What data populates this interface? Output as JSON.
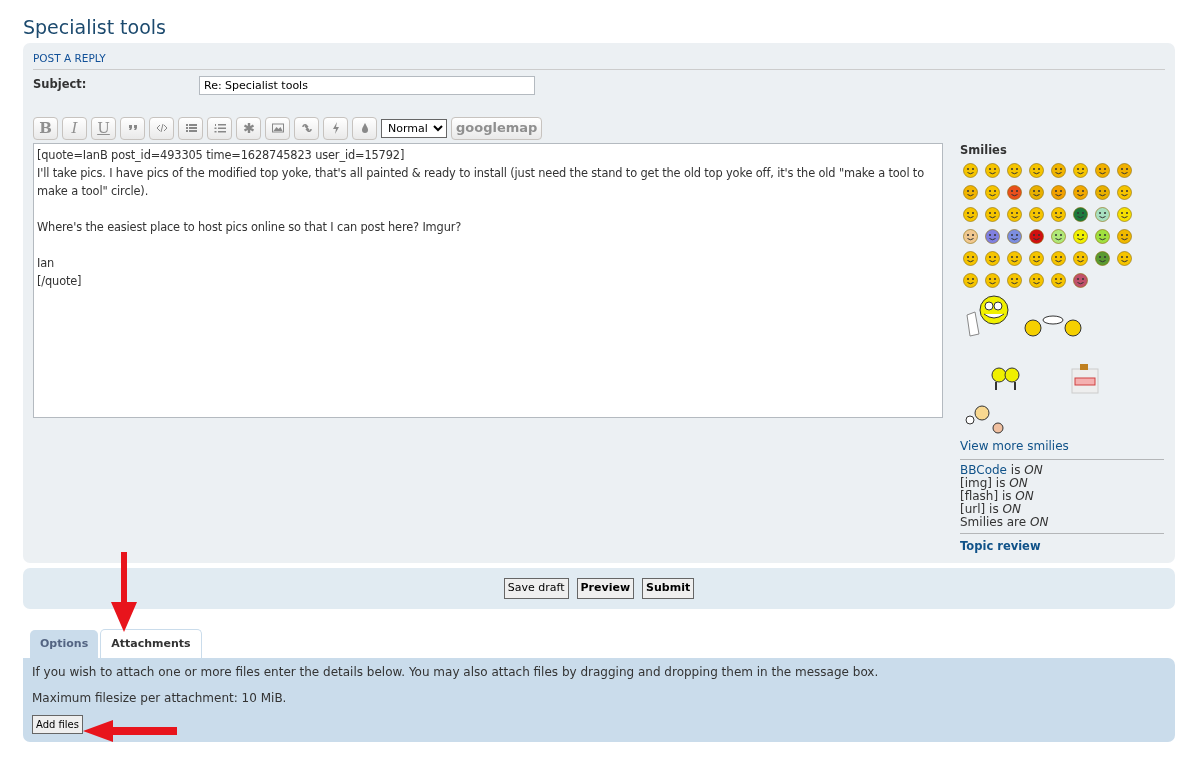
{
  "page_title": "Specialist tools",
  "post_panel": {
    "heading": "POST A REPLY",
    "subject_label": "Subject:",
    "subject_value": "Re: Specialist tools",
    "toolbar": [
      {
        "kind": "text",
        "label": "B"
      },
      {
        "kind": "text",
        "label": "I"
      },
      {
        "kind": "text",
        "label": "U"
      },
      {
        "kind": "icon"
      },
      {
        "kind": "icon"
      },
      {
        "kind": "icon"
      },
      {
        "kind": "icon"
      },
      {
        "kind": "icon"
      },
      {
        "kind": "icon"
      },
      {
        "kind": "icon"
      },
      {
        "kind": "icon"
      },
      {
        "kind": "icon"
      },
      {
        "kind": "select",
        "value": "Normal"
      },
      {
        "kind": "text",
        "label": "googlemap"
      }
    ],
    "message": "[quote=IanB post_id=493305 time=1628745823 user_id=15792]\nI'll take pics. I have pics of the modified top yoke, that's all painted & ready to install (just need the stand to get the old top yoke off, it's the old \"make a tool to make a tool\" circle).\n\nWhere's the easiest place to host pics online so that I can post here? Imgur?\n\nIan\n[/quote]",
    "smilies_heading": "Smilies",
    "smilies": [
      [
        {
          "color": "#f5c400"
        },
        {
          "color": "#f5c400"
        },
        {
          "color": "#f5c400"
        },
        {
          "color": "#f5c400"
        },
        {
          "color": "#f0b400"
        },
        {
          "color": "#f5c400"
        },
        {
          "color": "#f0b000"
        },
        {
          "color": "#f0b000"
        }
      ],
      [
        {
          "color": "#f0b400"
        },
        {
          "color": "#f5c400"
        },
        {
          "color": "#e8501c"
        },
        {
          "color": "#e8b000"
        },
        {
          "color": "#f0a000"
        },
        {
          "color": "#f0a800"
        },
        {
          "color": "#e8b000"
        },
        {
          "color": "#f5c400"
        }
      ],
      [
        {
          "color": "#f5c400"
        },
        {
          "color": "#f5c400"
        },
        {
          "color": "#f5c400"
        },
        {
          "color": "#f5c400"
        },
        {
          "color": "#f5c400"
        },
        {
          "color": "#1e7a3c"
        },
        {
          "color": "#a8e0c0"
        },
        {
          "color": "#f5e000"
        }
      ],
      [
        {
          "color": "#f0c890"
        },
        {
          "color": "#8080e0"
        },
        {
          "color": "#7c8ee0"
        },
        {
          "color": "#d01010"
        },
        {
          "color": "#b0e878"
        },
        {
          "color": "#f0f000"
        },
        {
          "color": "#a0e040"
        },
        {
          "color": "#f0b800"
        }
      ],
      [
        {
          "color": "#f5c400"
        },
        {
          "color": "#f5c400"
        },
        {
          "color": "#f5c400"
        },
        {
          "color": "#f5c400"
        },
        {
          "color": "#f5c400"
        },
        {
          "color": "#f5c400"
        },
        {
          "color": "#5a9a30"
        },
        {
          "color": "#f5c400"
        }
      ],
      [
        {
          "color": "#f5c400"
        },
        {
          "color": "#f5c400"
        },
        {
          "color": "#f5c400"
        },
        {
          "color": "#f5c400"
        },
        {
          "color": "#f5c400"
        },
        {
          "color": "#c0506a"
        }
      ]
    ],
    "more_smilies": "View more smilies",
    "status": [
      {
        "text": "BBCode",
        "link": true,
        "suffix": "is",
        "value": "ON"
      },
      {
        "text": "[img]",
        "link": false,
        "suffix": "is",
        "value": "ON"
      },
      {
        "text": "[flash]",
        "link": false,
        "suffix": "is",
        "value": "ON"
      },
      {
        "text": "[url]",
        "link": false,
        "suffix": "is",
        "value": "ON"
      },
      {
        "text": "Smilies",
        "link": false,
        "suffix": "are",
        "value": "ON"
      }
    ],
    "topic_review": "Topic review"
  },
  "submit_buttons": [
    {
      "label": "Save draft",
      "bold": false
    },
    {
      "label": "Preview",
      "bold": true
    },
    {
      "label": "Submit",
      "bold": true
    }
  ],
  "tabs": [
    {
      "label": "Options",
      "selected": false
    },
    {
      "label": "Attachments",
      "selected": true
    }
  ],
  "attach_panel": {
    "intro": "If you wish to attach one or more files enter the details below. You may also attach files by dragging and dropping them in the message box.",
    "max_size": "Maximum filesize per attachment: 10 MiB.",
    "add_button": "Add files"
  }
}
